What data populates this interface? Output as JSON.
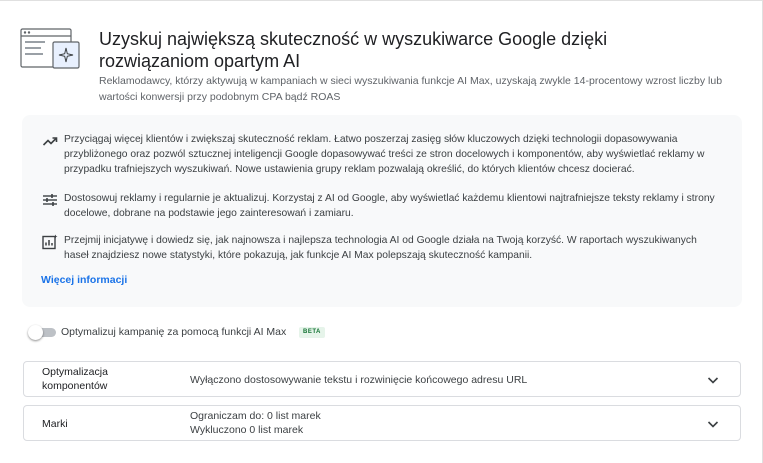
{
  "header": {
    "title": "Uzyskuj największą skuteczność w wyszukiwarce Google dzięki rozwiązaniom opartym AI",
    "subtitle": "Reklamodawcy, którzy aktywują w kampaniach w sieci wyszukiwania funkcje AI Max, uzyskają zwykle 14-procentowy wzrost liczby lub wartości konwersji przy podobnym CPA bądź ROAS",
    "illustration_icon": "browser-sparkle-illustration"
  },
  "info": {
    "features": [
      {
        "icon": "trending-up-icon",
        "text": "Przyciągaj więcej klientów i zwiększaj skuteczność reklam. Łatwo poszerzaj zasięg słów kluczowych dzięki technologii dopasowywania przybliżonego oraz pozwól sztucznej inteligencji Google dopasowywać treści ze stron docelowych i komponentów, aby wyświetlać reklamy w przypadku trafniejszych wyszukiwań. Nowe ustawienia grupy reklam pozwalają określić, do których klientów chcesz docierać."
      },
      {
        "icon": "tune-icon",
        "text": "Dostosowuj reklamy i regularnie je aktualizuj. Korzystaj z AI od Google, aby wyświetlać każdemu klientowi najtrafniejsze teksty reklamy i strony docelowe, dobrane na podstawie jego zainteresowań i zamiaru."
      },
      {
        "icon": "insights-chart-icon",
        "text": "Przejmij inicjatywę i dowiedz się, jak najnowsza i najlepsza technologia AI od Google działa na Twoją korzyść. W raportach wyszukiwanych haseł znajdziesz nowe statystyki, które pokazują, jak funkcje AI Max polepszają skuteczność kampanii."
      }
    ],
    "more_link": "Więcej informacji"
  },
  "toggle": {
    "label": "Optymalizuj kampanię za pomocą funkcji AI Max",
    "badge": "BETA",
    "enabled": false
  },
  "settings": [
    {
      "name": "Optymalizacja komponentów",
      "values": [
        "Wyłączono dostosowywanie tekstu i rozwinięcie końcowego adresu URL"
      ]
    },
    {
      "name": "Marki",
      "values": [
        "Ograniczam do: 0 list marek",
        "Wykluczono 0 list marek"
      ]
    }
  ],
  "colors": {
    "link": "#1a73e8",
    "info_bg": "#f8f9fa",
    "beta_bg": "#e6f4ea",
    "beta_text": "#137333",
    "illustration_accent": "#e8f0fe"
  }
}
